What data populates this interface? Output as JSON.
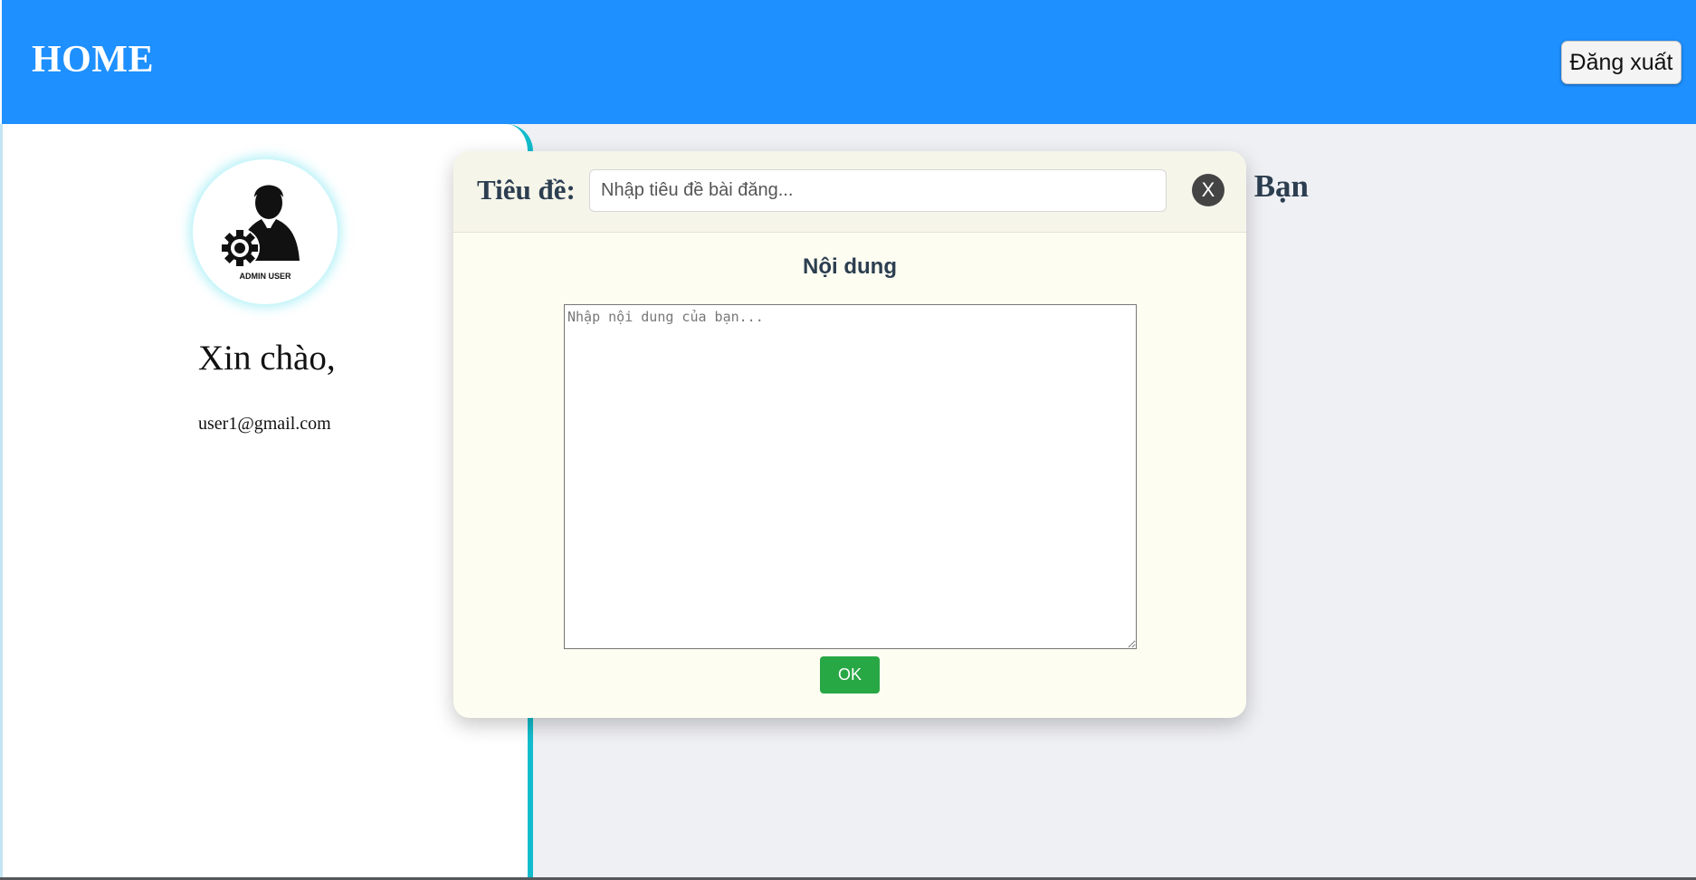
{
  "header": {
    "title": "HOME",
    "logout_label": "Đăng xuất",
    "background_color": "#1e90ff"
  },
  "sidebar": {
    "avatar_caption": "ADMIN USER",
    "greeting": "Xin chào,",
    "email": "user1@gmail.com",
    "accent_color": "#13bccc"
  },
  "main": {
    "heading_visible_fragment": "ủa Bạn"
  },
  "modal": {
    "title_label": "Tiêu đề:",
    "title_placeholder": "Nhập tiêu đề bài đăng...",
    "close_label": "X",
    "content_label": "Nội dung",
    "content_placeholder": "Nhập nội dung của bạn...",
    "ok_label": "OK",
    "ok_color": "#28a745"
  }
}
